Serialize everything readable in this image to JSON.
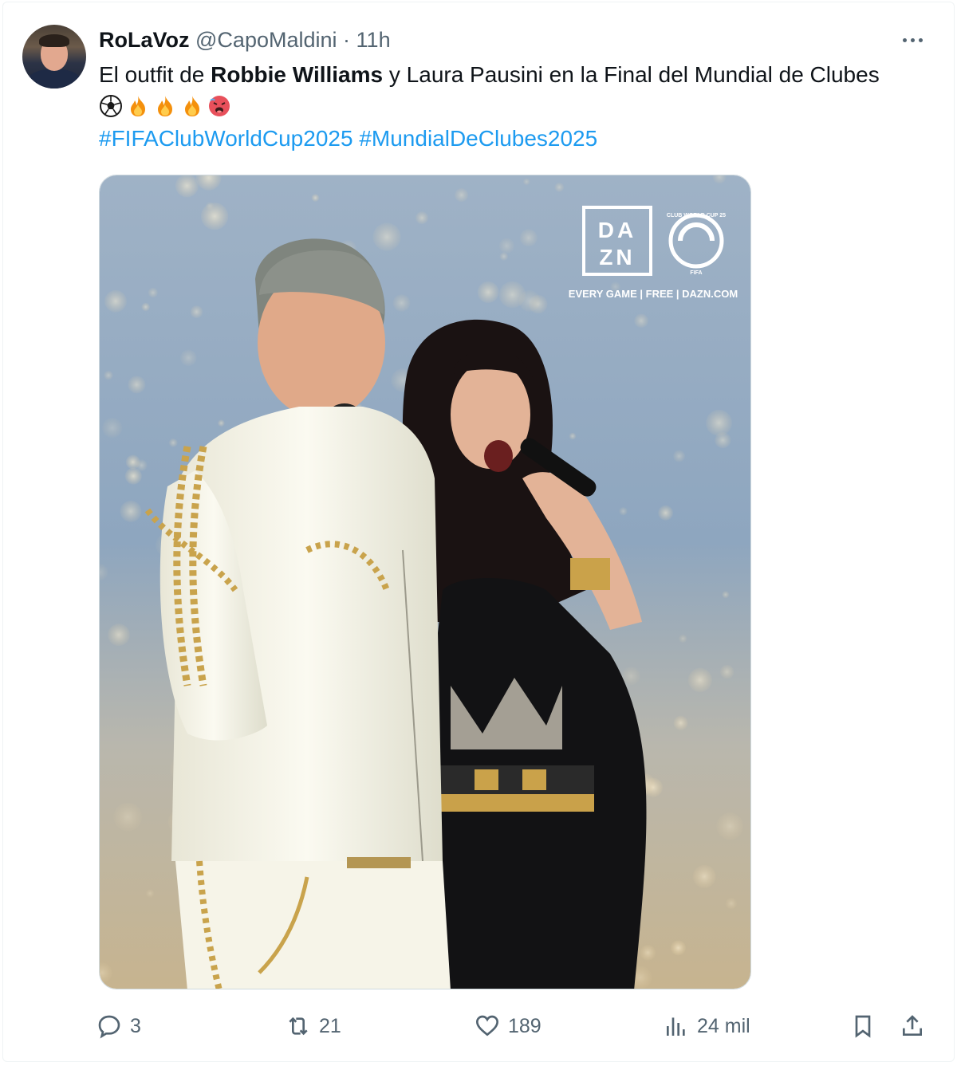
{
  "author": {
    "display_name": "RoLaVoz",
    "handle": "@CapoMaldini",
    "separator": "·",
    "time": "11h"
  },
  "tweet": {
    "text_before": "El outfit de ",
    "text_bold": "Robbie Williams",
    "text_after": " y Laura Pausini en la Final del Mundial de Clubes",
    "emojis": [
      "soccer-ball",
      "fire",
      "fire",
      "fire",
      "hot-face"
    ],
    "hashtag_1": "#FIFAClubWorldCup2025",
    "hashtag_2": "#MundialDeClubes2025"
  },
  "media": {
    "logo_line1": "DA",
    "logo_line2": "ZN",
    "tagline": "EVERY GAME | FREE | DAZN.COM",
    "badge_text": "CLUB WORLD CUP 25",
    "badge_sub": "FIFA"
  },
  "actions": {
    "replies": "3",
    "reposts": "21",
    "likes": "189",
    "views": "24 mil"
  },
  "icons": {
    "more": "more-icon",
    "reply": "reply-icon",
    "repost": "repost-icon",
    "like": "heart-icon",
    "views": "views-icon",
    "bookmark": "bookmark-icon",
    "share": "share-icon"
  },
  "colors": {
    "link": "#1d9bf0",
    "muted": "#536471",
    "text": "#0f1419"
  }
}
